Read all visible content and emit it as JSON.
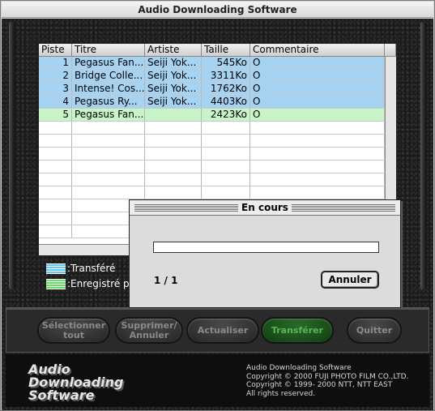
{
  "window": {
    "title": "Audio Downloading Software"
  },
  "table": {
    "headers": [
      "Piste",
      "Titre",
      "Artiste",
      "Taille",
      "Commentaire"
    ],
    "rows": [
      {
        "track": "1",
        "title": "Pegasus Fan...",
        "artist": "Seiji Yok...",
        "size": "545Ko",
        "comment": "O",
        "status": "transferred"
      },
      {
        "track": "2",
        "title": "Bridge Colle...",
        "artist": "Seiji Yok...",
        "size": "3311Ko",
        "comment": "O",
        "status": "transferred"
      },
      {
        "track": "3",
        "title": "Intense! Cos...",
        "artist": "Seiji Yok...",
        "size": "1762Ko",
        "comment": "O",
        "status": "transferred"
      },
      {
        "track": "4",
        "title": "Pegasus Ry...",
        "artist": "Seiji Yok...",
        "size": "4403Ko",
        "comment": "O",
        "status": "transferred"
      },
      {
        "track": "5",
        "title": "Pegasus Fan...",
        "artist": "",
        "size": "2423Ko",
        "comment": "O",
        "status": "recorded"
      }
    ]
  },
  "legend": {
    "transferred": ":Transféré",
    "recorded": ":Enregistré p"
  },
  "buttons": {
    "select_all": "Sélectionner tout",
    "delete_cancel": "Supprimer/ Annuler",
    "refresh": "Actualiser",
    "transfer": "Transférer",
    "quit": "Quitter"
  },
  "footer": {
    "logo_line1": "Audio",
    "logo_line2": "Downloading",
    "logo_line3": "Software",
    "copyright_line1": "Audio Downloading Software",
    "copyright_line2": "Copyright © 2000 FUJI PHOTO FILM CO.,LTD.",
    "copyright_line3": "Copyright © 1999- 2000 NTT, NTT EAST",
    "copyright_line4": "All rights reserved."
  },
  "dialog": {
    "title": "En cours",
    "progress": 0,
    "count": "1 / 1",
    "cancel_label": "Annuler"
  },
  "colors": {
    "transferred_row": "#a6d3f2",
    "recorded_row": "#c8f4c8",
    "active_button": "#1f5a1f"
  }
}
